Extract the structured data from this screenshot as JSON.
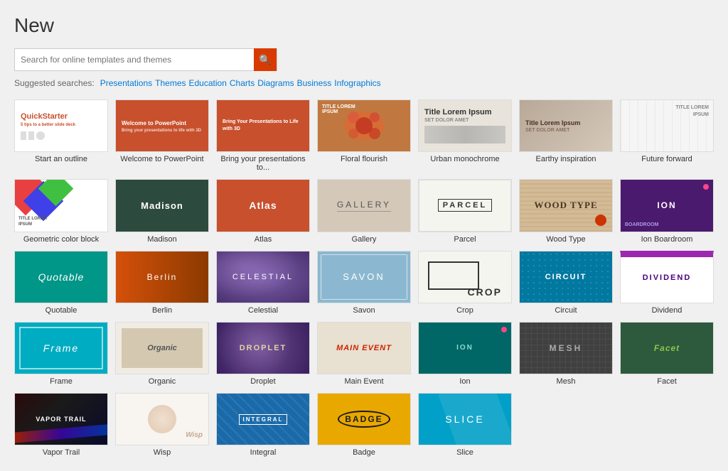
{
  "page": {
    "title": "New",
    "search": {
      "placeholder": "Search for online templates and themes",
      "button_icon": "🔍"
    },
    "suggested": {
      "label": "Suggested searches:",
      "links": [
        "Presentations",
        "Themes",
        "Education",
        "Charts",
        "Diagrams",
        "Business",
        "Infographics"
      ]
    },
    "templates": [
      {
        "id": "quickstarter",
        "label": "Start an outline",
        "style": "quickstarter"
      },
      {
        "id": "welcome-ppt",
        "label": "Welcome to PowerPoint",
        "style": "welcome-ppt"
      },
      {
        "id": "bring",
        "label": "Bring your presentations to...",
        "style": "bring"
      },
      {
        "id": "floral",
        "label": "Floral flourish",
        "style": "floral"
      },
      {
        "id": "urban",
        "label": "Urban monochrome",
        "style": "urban"
      },
      {
        "id": "earthy",
        "label": "Earthy inspiration",
        "style": "earthy"
      },
      {
        "id": "future",
        "label": "Future forward",
        "style": "future"
      },
      {
        "id": "geo",
        "label": "Geometric color block",
        "style": "geo"
      },
      {
        "id": "madison",
        "label": "Madison",
        "style": "madison"
      },
      {
        "id": "atlas",
        "label": "Atlas",
        "style": "atlas"
      },
      {
        "id": "gallery",
        "label": "Gallery",
        "style": "gallery"
      },
      {
        "id": "parcel",
        "label": "Parcel",
        "style": "parcel"
      },
      {
        "id": "woodtype",
        "label": "Wood Type",
        "style": "woodtype"
      },
      {
        "id": "ion-board",
        "label": "Ion Boardroom",
        "style": "ion-board"
      },
      {
        "id": "quotable",
        "label": "Quotable",
        "style": "quotable"
      },
      {
        "id": "berlin",
        "label": "Berlin",
        "style": "berlin"
      },
      {
        "id": "celestial",
        "label": "Celestial",
        "style": "celestial"
      },
      {
        "id": "savon",
        "label": "Savon",
        "style": "savon"
      },
      {
        "id": "crop",
        "label": "Crop",
        "style": "crop"
      },
      {
        "id": "circuit",
        "label": "Circuit",
        "style": "circuit"
      },
      {
        "id": "dividend",
        "label": "Dividend",
        "style": "dividend"
      },
      {
        "id": "frame",
        "label": "Frame",
        "style": "frame"
      },
      {
        "id": "organic",
        "label": "Organic",
        "style": "organic"
      },
      {
        "id": "droplet",
        "label": "Droplet",
        "style": "droplet"
      },
      {
        "id": "mainevent",
        "label": "Main Event",
        "style": "mainevent"
      },
      {
        "id": "ion",
        "label": "Ion",
        "style": "ion"
      },
      {
        "id": "mesh",
        "label": "Mesh",
        "style": "mesh"
      },
      {
        "id": "facet",
        "label": "Facet",
        "style": "facet"
      },
      {
        "id": "vaportrail",
        "label": "Vapor Trail",
        "style": "vaportrail"
      },
      {
        "id": "wisp",
        "label": "Wisp",
        "style": "wisp"
      },
      {
        "id": "integral",
        "label": "Integral",
        "style": "integral"
      },
      {
        "id": "badge",
        "label": "Badge",
        "style": "badge"
      },
      {
        "id": "slice",
        "label": "Slice",
        "style": "slice"
      }
    ]
  }
}
